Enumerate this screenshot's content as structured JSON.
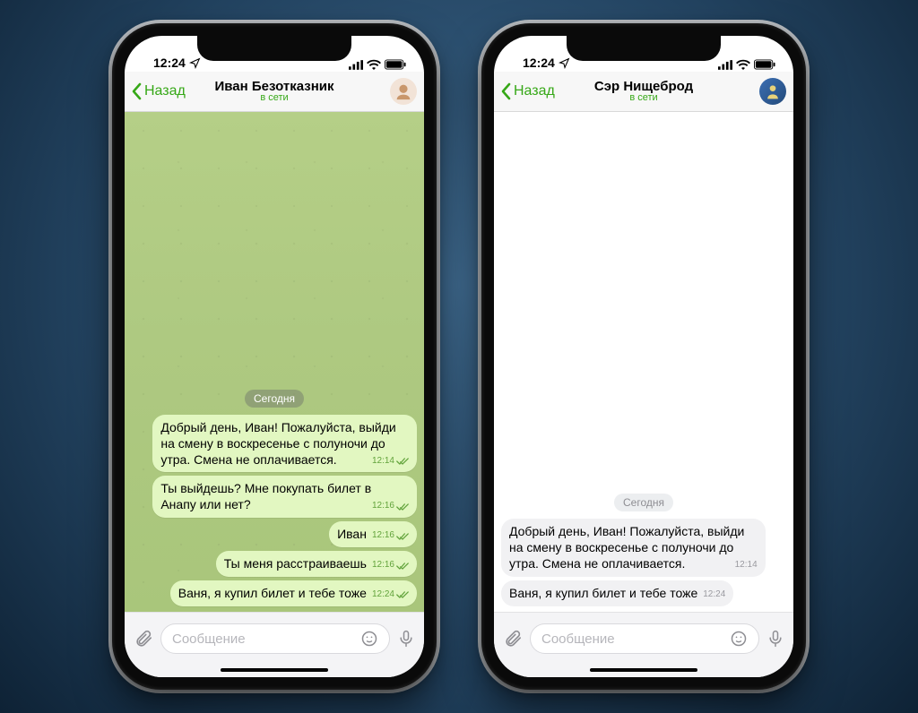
{
  "status_time": "12:24",
  "phones": [
    {
      "back_label": "Назад",
      "name": "Иван Безотказник",
      "sub": "в сети",
      "date": "Сегодня",
      "input_placeholder": "Сообщение",
      "messages": [
        {
          "text": "Добрый день, Иван! Пожалуйста, выйди на смену в воскресенье с полуночи до утра. Смена не оплачивается.",
          "time": "12:14"
        },
        {
          "text": "Ты выйдешь? Мне покупать билет в Анапу или нет?",
          "time": "12:16"
        },
        {
          "text": "Иван",
          "time": "12:16"
        },
        {
          "text": "Ты меня расстраиваешь",
          "time": "12:16"
        },
        {
          "text": "Ваня, я купил билет и тебе тоже",
          "time": "12:24"
        }
      ]
    },
    {
      "back_label": "Назад",
      "name": "Сэр Нищеброд",
      "sub": "в сети",
      "date": "Сегодня",
      "input_placeholder": "Сообщение",
      "messages": [
        {
          "text": "Добрый день, Иван! Пожалуйста, выйди на смену в воскресенье с полуночи до утра. Смена не оплачивается.",
          "time": "12:14"
        },
        {
          "text": "Ваня, я купил билет и тебе тоже",
          "time": "12:24"
        }
      ]
    }
  ]
}
